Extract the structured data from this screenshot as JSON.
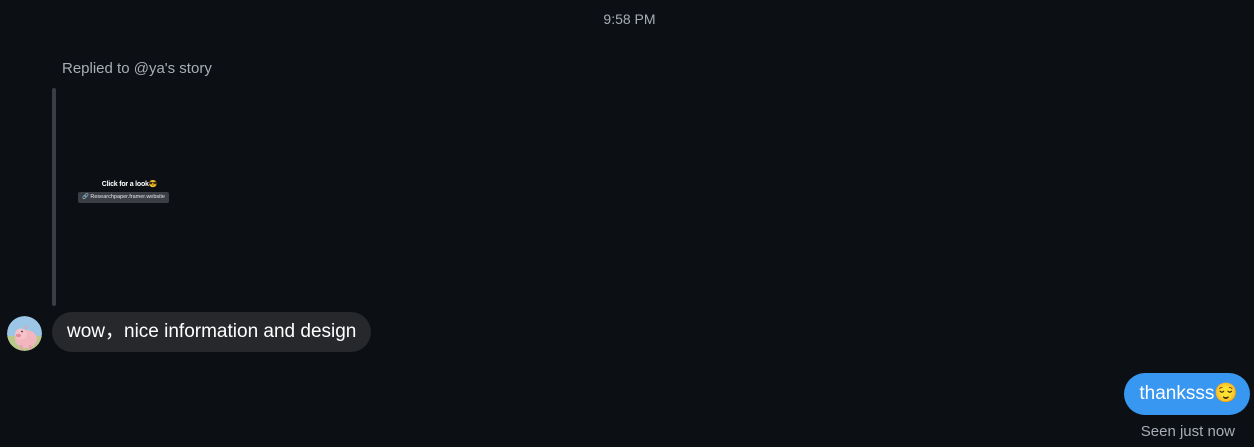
{
  "conversation": {
    "timestamp": "9:58 PM",
    "reply": {
      "label": "Replied to @ya's story",
      "story_caption": "Click for a look😎",
      "story_link": "🔗 Researchpaper.framer.website"
    },
    "incoming": {
      "text": "wow，nice information and design",
      "avatar_icon": "pig-avatar"
    },
    "outgoing": {
      "text": "thanksss😌",
      "status": "Seen just now"
    }
  },
  "colors": {
    "background": "#0c0f14",
    "incoming_bubble": "#26282c",
    "outgoing_bubble": "#3897f0",
    "muted_text": "#a8adb6"
  }
}
